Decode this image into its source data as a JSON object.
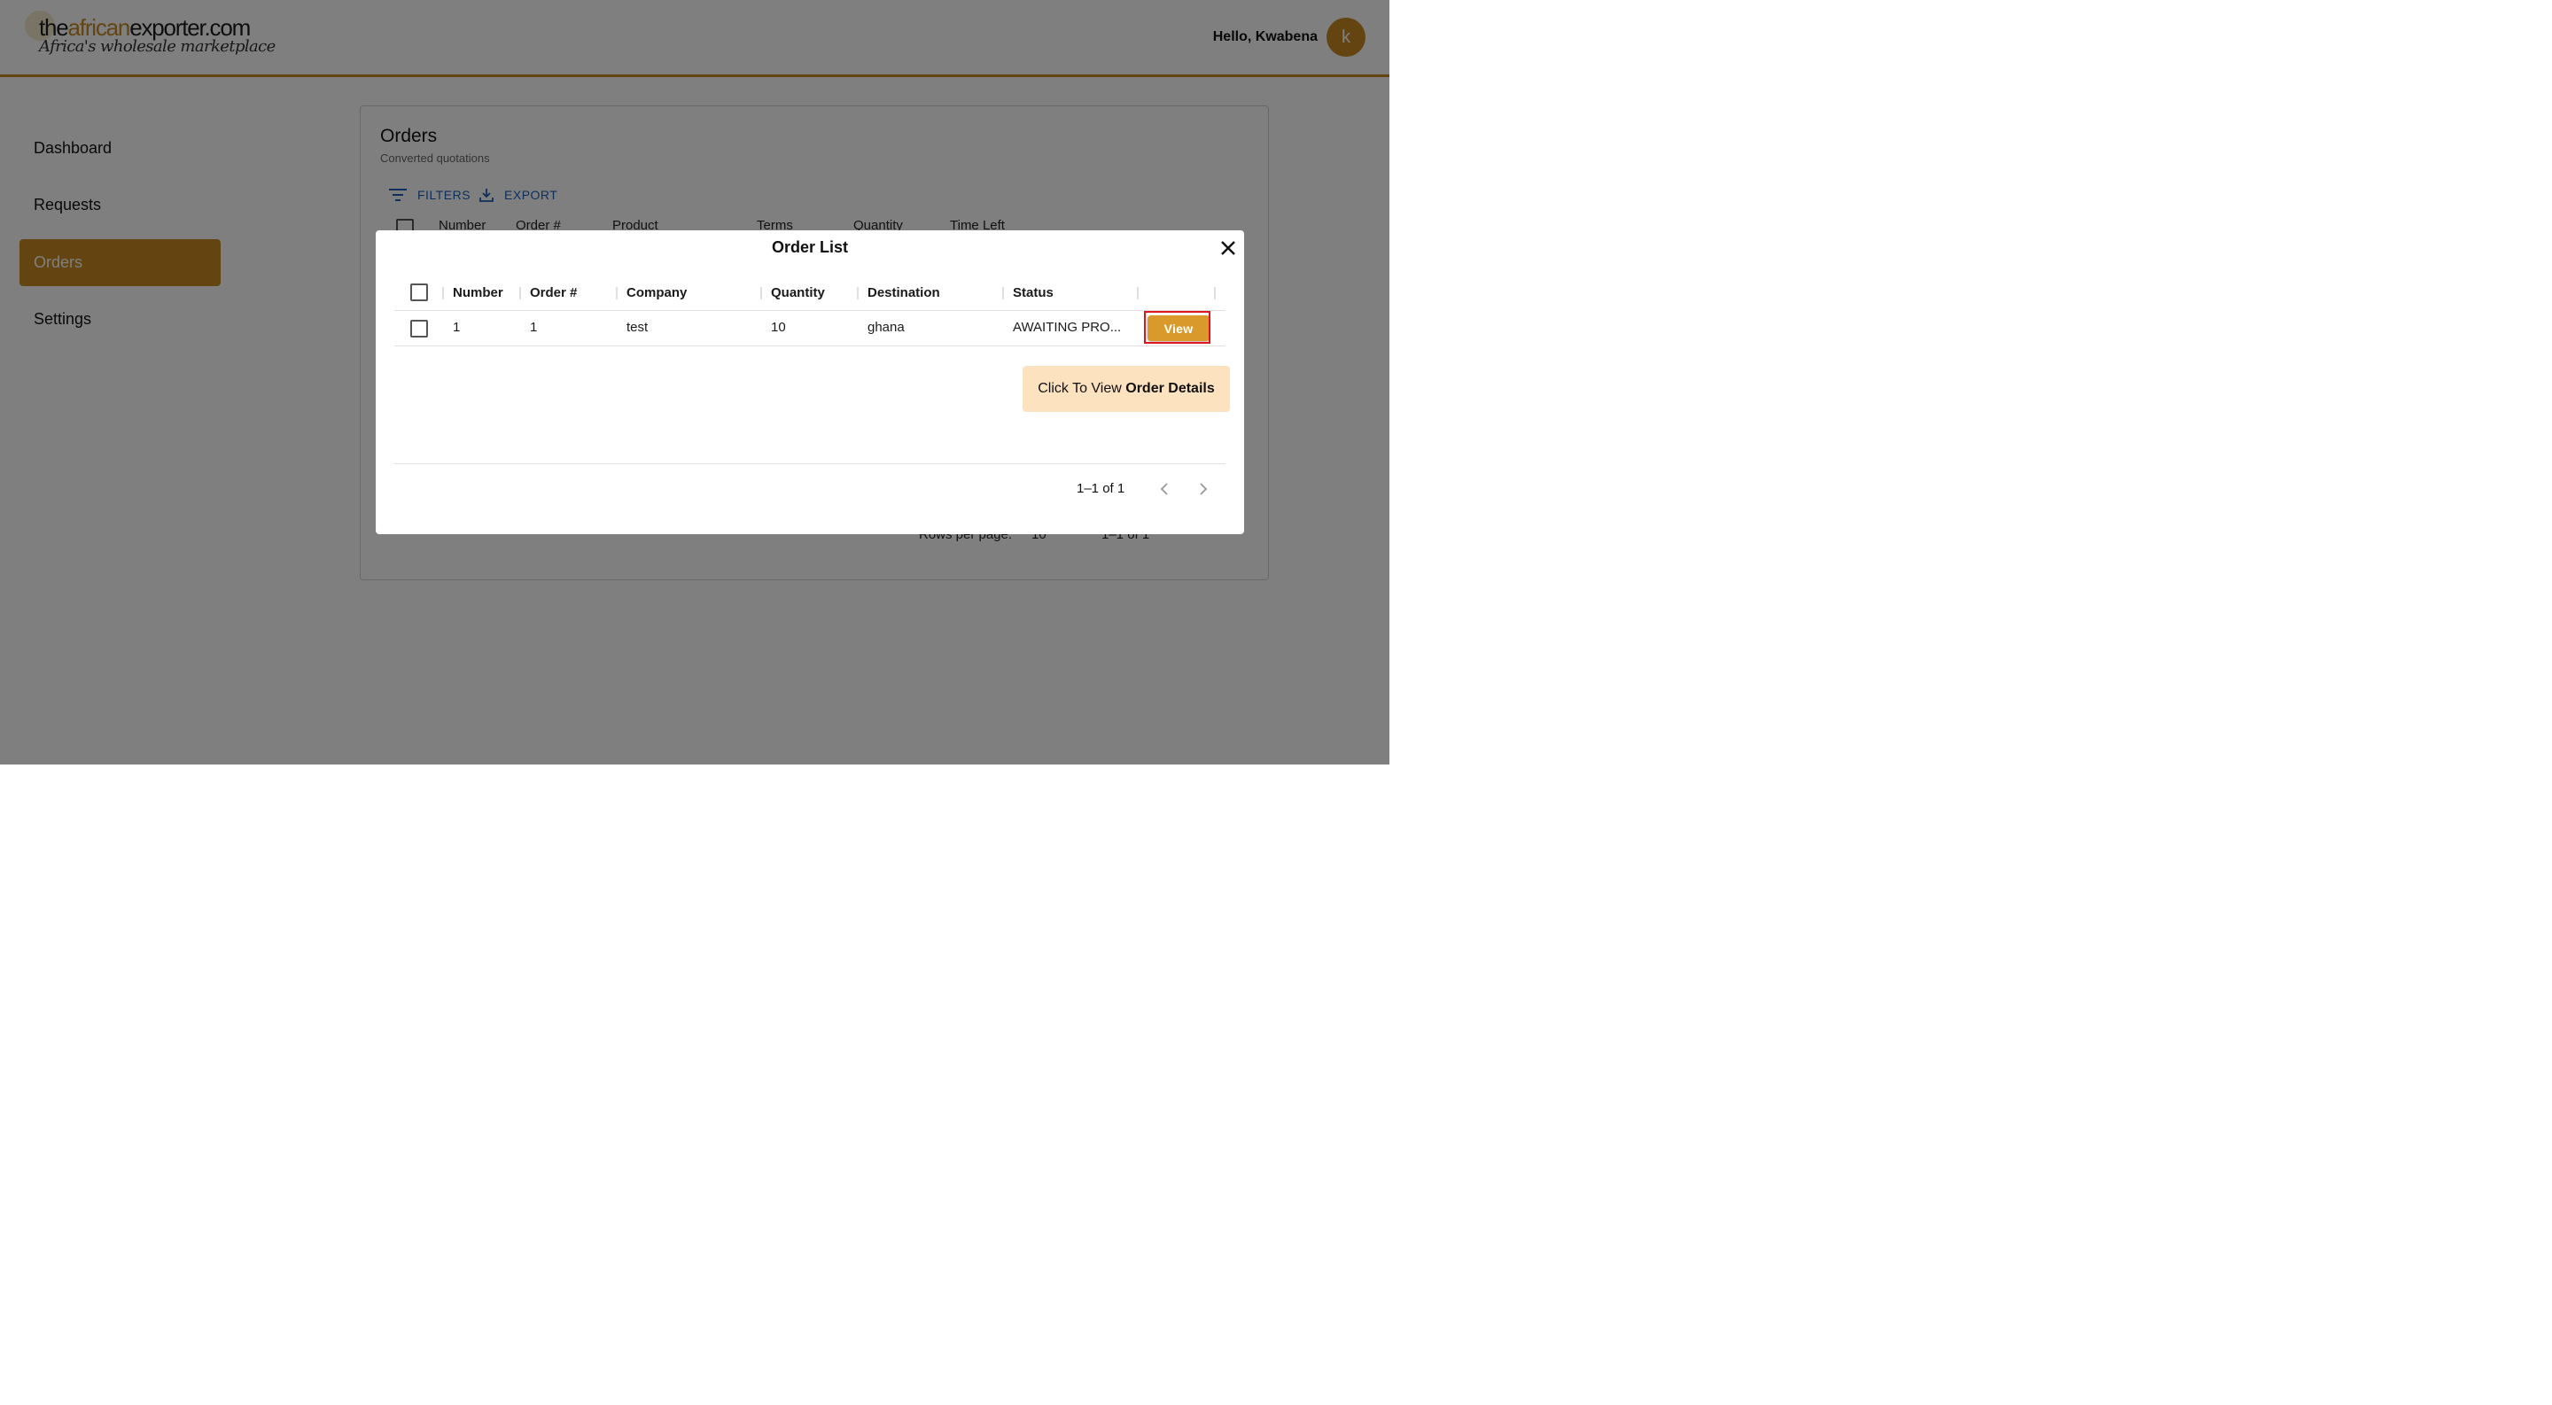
{
  "header": {
    "logo_text_dark1": "the",
    "logo_text_gold": "african",
    "logo_text_dark2": "exporter.com",
    "logo_tagline": "Africa's wholesale marketplace",
    "greeting": "Hello, Kwabena",
    "avatar_initial": "k"
  },
  "sidebar": {
    "items": [
      {
        "label": "Dashboard",
        "active": false
      },
      {
        "label": "Requests",
        "active": false
      },
      {
        "label": "Orders",
        "active": true
      },
      {
        "label": "Settings",
        "active": false
      }
    ]
  },
  "orders_card": {
    "title": "Orders",
    "subtitle": "Converted quotations",
    "filters_label": "FILTERS",
    "export_label": "EXPORT",
    "columns": [
      "Number",
      "Order #",
      "Product",
      "Terms",
      "Quantity",
      "Time Left"
    ],
    "rows_per_page_label": "Rows per page:",
    "rows_per_page_value": "10",
    "pagination": "1–1 of 1"
  },
  "modal": {
    "title": "Order List",
    "columns": [
      "Number",
      "Order #",
      "Company",
      "Quantity",
      "Destination",
      "Status"
    ],
    "rows": [
      {
        "number": "1",
        "order": "1",
        "company": "test",
        "quantity": "10",
        "destination": "ghana",
        "status": "AWAITING PRO...",
        "action": "View"
      }
    ],
    "tooltip_prefix": "Click To View ",
    "tooltip_bold": "Order Details",
    "pagination": "1–1 of 1"
  },
  "colors": {
    "brand": "#c98a24",
    "button": "#d99a2b",
    "link": "#1c5fb8",
    "tooltip_bg": "#fde2c0",
    "highlight": "#e0141c"
  }
}
